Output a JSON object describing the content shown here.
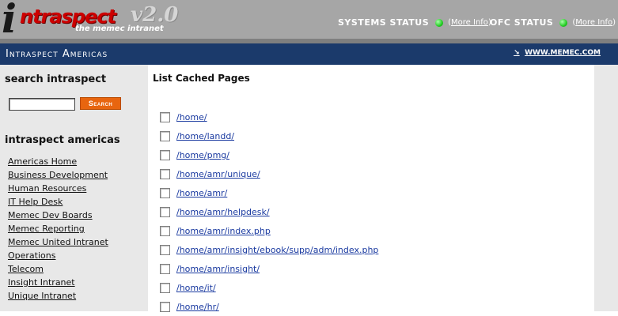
{
  "header": {
    "logo_i": "i",
    "logo_text": "ntraspect",
    "logo_sub": "the memec intranet",
    "logo_version": "v2.0",
    "systems_status_label": "SYSTEMS STATUS",
    "systems_more": "More Info",
    "ofc_status_label": "OFC STATUS",
    "ofc_more": "More Info",
    "status_color": "#22cc22"
  },
  "bar": {
    "title": "Intraspect Americas",
    "link": "WWW.MEMEC.COM",
    "color": "#1b3a6b"
  },
  "sidebar": {
    "search_heading": "search intraspect",
    "search_value": "",
    "search_button": "Search",
    "section_heading": "intraspect americas",
    "items": [
      "Americas Home",
      "Business Development",
      "Human Resources",
      "IT Help Desk",
      "Memec Dev Boards",
      "Memec Reporting",
      "Memec United Intranet",
      "Operations",
      "Telecom",
      "Insight Intranet",
      "Unique Intranet"
    ]
  },
  "main": {
    "title": "List Cached Pages",
    "pages": [
      "/home/",
      "/home/landd/",
      "/home/pmg/",
      "/home/amr/unique/",
      "/home/amr/",
      "/home/amr/helpdesk/",
      "/home/amr/index.php",
      "/home/amr/insight/ebook/supp/adm/index.php",
      "/home/amr/insight/",
      "/home/it/",
      "/home/hr/"
    ]
  }
}
